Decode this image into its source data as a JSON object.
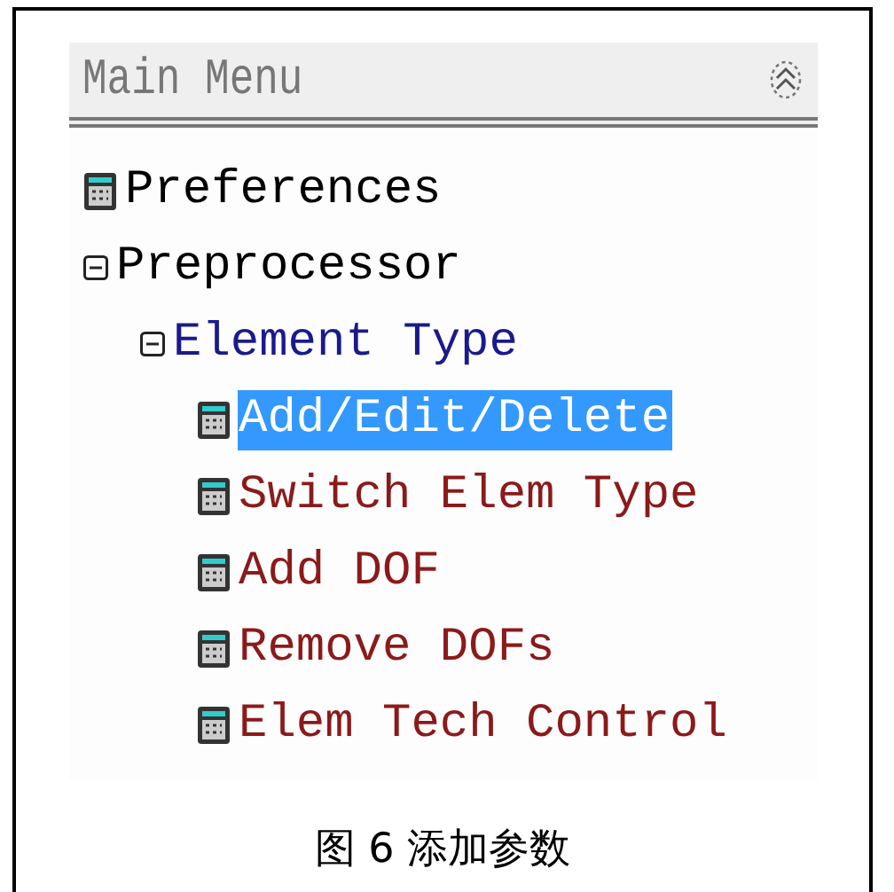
{
  "panel": {
    "title": "Main Menu"
  },
  "tree": [
    {
      "kind": "leaf",
      "label": "Preferences",
      "color": "#000000",
      "selected": false
    },
    {
      "kind": "folder",
      "label": "Preprocessor",
      "color": "#000000",
      "expanded": true,
      "children": [
        {
          "kind": "folder",
          "label": "Element Type",
          "color": "#1a1a8c",
          "expanded": true,
          "children": [
            {
              "kind": "leaf",
              "label": "Add/Edit/Delete",
              "selected": true
            },
            {
              "kind": "leaf",
              "label": "Switch Elem Type",
              "color": "#8b1a1a",
              "selected": false
            },
            {
              "kind": "leaf",
              "label": "Add DOF",
              "color": "#8b1a1a",
              "selected": false
            },
            {
              "kind": "leaf",
              "label": "Remove DOFs",
              "color": "#8b1a1a",
              "selected": false
            },
            {
              "kind": "leaf",
              "label": "Elem Tech Control",
              "color": "#8b1a1a",
              "selected": false
            }
          ]
        }
      ]
    }
  ],
  "caption": "图 6 添加参数"
}
